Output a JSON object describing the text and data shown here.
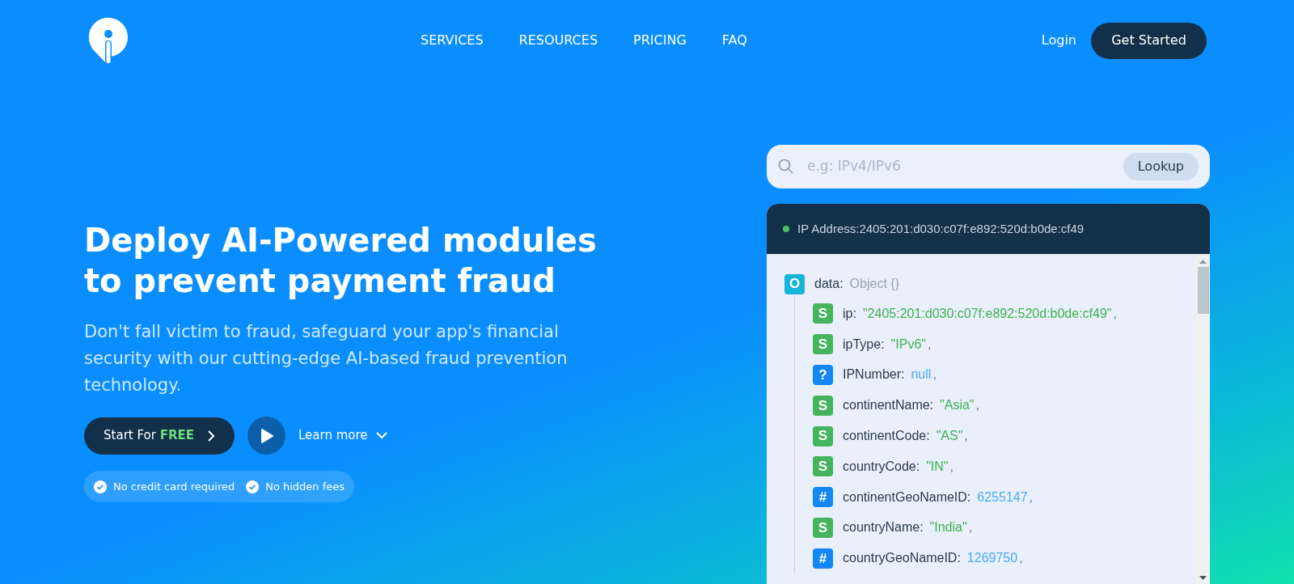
{
  "nav": {
    "links": [
      "SERVICES",
      "RESOURCES",
      "PRICING",
      "FAQ"
    ],
    "login": "Login",
    "cta": "Get Started"
  },
  "hero": {
    "title": "Deploy AI-Powered modules to prevent payment fraud",
    "subtitle": "Don't fall victim to fraud, safeguard your app's financial security with our cutting-edge AI-based fraud prevention technology.",
    "start_button": "Start For **FREE**",
    "learn_more": "Learn more",
    "perks": [
      "No credit card required",
      "No hidden fees"
    ]
  },
  "lookup": {
    "placeholder": "e.g: IPv4/IPv6",
    "button": "Lookup"
  },
  "result": {
    "header": "IP Address:2405:201:d030:c07f:e892:520d:b0de:cf49",
    "root": {
      "kind": "object",
      "badge": "O",
      "key": "data:",
      "value": "Object {}"
    },
    "fields": [
      {
        "kind": "string",
        "badge": "S",
        "key": "ip:",
        "value": "\"2405:201:d030:c07f:e892:520d:b0de:cf49\"",
        "punct": ","
      },
      {
        "kind": "string",
        "badge": "S",
        "key": "ipType:",
        "value": "\"IPv6\"",
        "punct": ","
      },
      {
        "kind": "null",
        "badge": "?",
        "key": "IPNumber:",
        "value": "null",
        "punct": ","
      },
      {
        "kind": "string",
        "badge": "S",
        "key": "continentName:",
        "value": "\"Asia\"",
        "punct": ","
      },
      {
        "kind": "string",
        "badge": "S",
        "key": "continentCode:",
        "value": "\"AS\"",
        "punct": ","
      },
      {
        "kind": "string",
        "badge": "S",
        "key": "countryCode:",
        "value": "\"IN\"",
        "punct": ","
      },
      {
        "kind": "number",
        "badge": "#",
        "key": "continentGeoNameID:",
        "value": "6255147",
        "punct": ","
      },
      {
        "kind": "string",
        "badge": "S",
        "key": "countryName:",
        "value": "\"India\"",
        "punct": ","
      },
      {
        "kind": "number",
        "badge": "#",
        "key": "countryGeoNameID:",
        "value": "1269750",
        "punct": ","
      }
    ]
  }
}
